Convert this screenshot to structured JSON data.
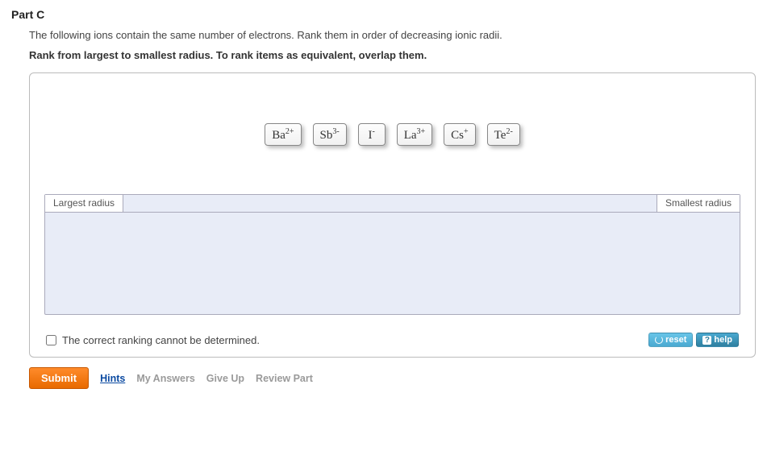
{
  "part": {
    "title": "Part C"
  },
  "question": "The following ions contain the same number of electrons. Rank them in order of decreasing ionic radii.",
  "instruction": "Rank from largest to smallest radius. To rank items as equivalent, overlap them.",
  "ions": [
    {
      "base": "Ba",
      "charge": "2+"
    },
    {
      "base": "Sb",
      "charge": "3-"
    },
    {
      "base": "I",
      "charge": "-"
    },
    {
      "base": "La",
      "charge": "3+"
    },
    {
      "base": "Cs",
      "charge": "+"
    },
    {
      "base": "Te",
      "charge": "2-"
    }
  ],
  "dropzone": {
    "left_label": "Largest radius",
    "right_label": "Smallest radius"
  },
  "checkbox_label": "The correct ranking cannot be determined.",
  "buttons": {
    "reset": "reset",
    "help": "help",
    "submit": "Submit",
    "hints": "Hints",
    "my_answers": "My Answers",
    "give_up": "Give Up",
    "review": "Review Part"
  }
}
